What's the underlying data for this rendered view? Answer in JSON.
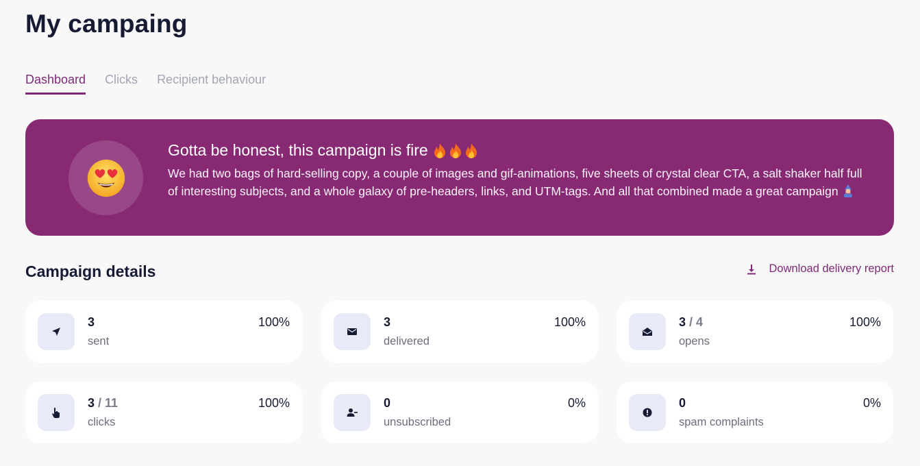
{
  "page": {
    "title": "My campaing"
  },
  "tabs": [
    {
      "label": "Dashboard",
      "active": true
    },
    {
      "label": "Clicks",
      "active": false
    },
    {
      "label": "Recipient behaviour",
      "active": false
    }
  ],
  "banner": {
    "title": "Gotta be honest, this campaign is fire",
    "text": "We had two bags of hard-selling copy, a couple of images and gif-animations, five sheets of crystal clear CTA, a salt shaker half full of interesting subjects, and a whole galaxy of pre-headers, links, and UTM-tags. And all that combined made a great campaign",
    "face_emoji": "heart-eyes-icon",
    "title_emoji": "fire-icon",
    "end_emoji": "mage-icon",
    "background": "#882a73"
  },
  "details": {
    "title": "Campaign details",
    "download_label": "Download delivery report",
    "cards": [
      {
        "icon": "paper-plane-icon",
        "value": "3",
        "total": "",
        "label": "sent",
        "percent": "100%"
      },
      {
        "icon": "envelope-icon",
        "value": "3",
        "total": "",
        "label": "delivered",
        "percent": "100%"
      },
      {
        "icon": "envelope-open-icon",
        "value": "3",
        "total": " / 4",
        "label": "opens",
        "percent": "100%"
      },
      {
        "icon": "pointer-hand-icon",
        "value": "3",
        "total": " / 11",
        "label": "clicks",
        "percent": "100%"
      },
      {
        "icon": "user-minus-icon",
        "value": "0",
        "total": "",
        "label": "unsubscribed",
        "percent": "0%"
      },
      {
        "icon": "exclamation-circle-icon",
        "value": "0",
        "total": "",
        "label": "spam complaints",
        "percent": "0%"
      }
    ]
  },
  "colors": {
    "accent": "#7e2a76",
    "icon_bg": "#e8ebf7",
    "heading": "#161b33"
  }
}
